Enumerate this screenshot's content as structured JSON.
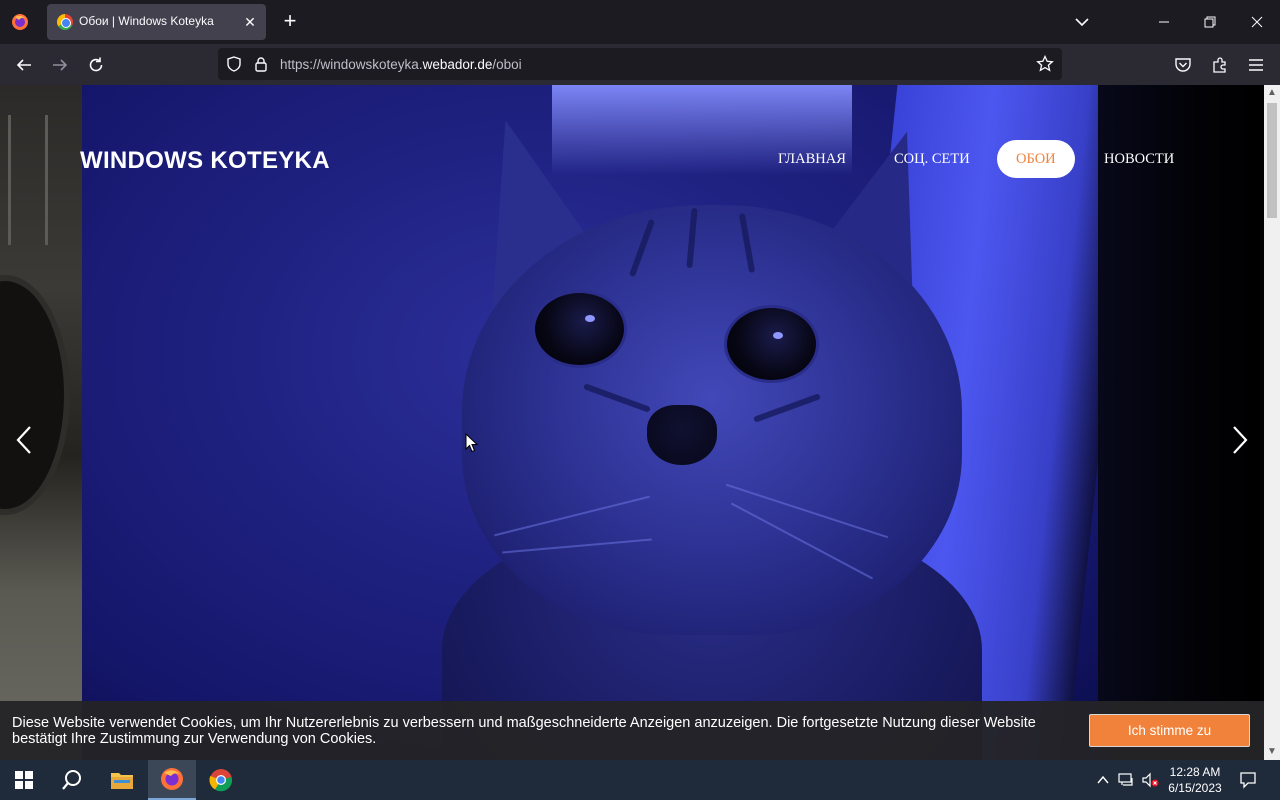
{
  "browser": {
    "tab_title": "Обои | Windows Koteyka",
    "tab_close": "✕",
    "new_tab": "+",
    "url_prefix": "https://windowskoteyka.",
    "url_domain": "webador.de",
    "url_suffix": "/oboi"
  },
  "site": {
    "title": "WINDOWS KOTEYKA",
    "nav": [
      {
        "label": "ГЛАВНАЯ",
        "active": false
      },
      {
        "label": "СОЦ. СЕТИ",
        "active": false
      },
      {
        "label": "ОБОИ",
        "active": true
      },
      {
        "label": "НОВОСТИ",
        "active": false
      }
    ],
    "accent_color": "#f0823c"
  },
  "cookie": {
    "text": "Diese Website verwendet Cookies, um Ihr Nutzererlebnis zu verbessern und maßgeschneiderte Anzeigen anzuzeigen. Die fortgesetzte Nutzung dieser Website bestätigt Ihre Zustimmung zur Verwendung von Cookies.",
    "button": "Ich stimme zu"
  },
  "taskbar": {
    "time": "12:28 AM",
    "date": "6/15/2023"
  },
  "icons": {
    "browser": [
      "firefox-menu-icon",
      "chevron-down-icon",
      "minimize-icon",
      "restore-icon",
      "close-icon",
      "back-icon",
      "forward-icon",
      "reload-icon",
      "shield-icon",
      "lock-icon",
      "star-icon",
      "pocket-icon",
      "extensions-icon",
      "hamburger-icon"
    ],
    "taskbar": [
      "windows-start-icon",
      "search-icon",
      "file-explorer-icon",
      "firefox-icon",
      "chrome-icon",
      "tray-chevron-icon",
      "network-icon",
      "volume-muted-icon",
      "notification-icon"
    ]
  }
}
